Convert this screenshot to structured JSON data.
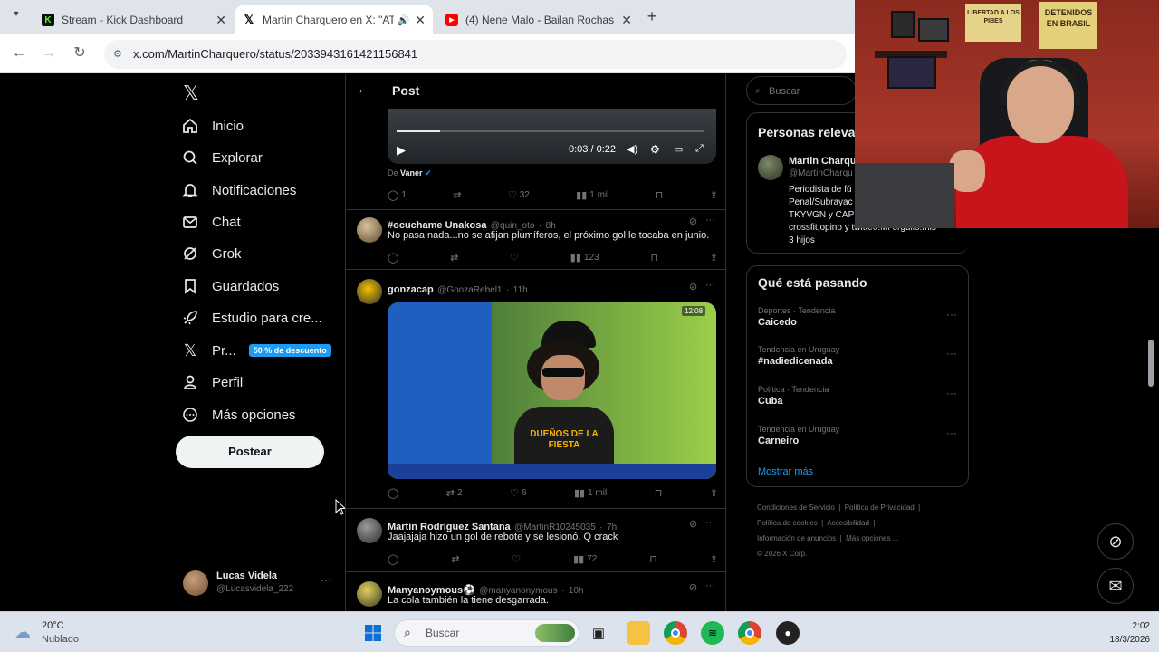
{
  "browser": {
    "tabs": [
      {
        "title": "Stream - Kick Dashboard",
        "icon": "kick-icon",
        "color": "#53fc18"
      },
      {
        "title": "Martin Charquero en X: \"AT",
        "icon": "x-logo-icon"
      },
      {
        "title": "(4) Nene Malo - Bailan Rochas",
        "icon": "youtube-icon",
        "color": "#ff0000"
      }
    ],
    "url": "x.com/MartinCharquero/status/2033943161421156841"
  },
  "header": {
    "title": "Post"
  },
  "nav": {
    "items": [
      {
        "label": "Inicio",
        "icon": "home-icon"
      },
      {
        "label": "Explorar",
        "icon": "search-icon"
      },
      {
        "label": "Notificaciones",
        "icon": "bell-icon"
      },
      {
        "label": "Chat",
        "icon": "mail-icon"
      },
      {
        "label": "Grok",
        "icon": "grok-icon"
      },
      {
        "label": "Guardados",
        "icon": "bookmark-icon"
      },
      {
        "label": "Estudio para cre...",
        "icon": "rocket-icon"
      },
      {
        "label": "Pr...",
        "icon": "x-premium-icon"
      },
      {
        "label": "Perfil",
        "icon": "person-icon"
      },
      {
        "label": "Más opciones",
        "icon": "more-circle-icon"
      }
    ],
    "premium_badge": "50 % de descuento",
    "post_button": "Postear",
    "user": {
      "name": "Lucas Videla",
      "handle": "@Lucasvidela_222"
    }
  },
  "video": {
    "time": "0:03 / 0:22",
    "from_label": "De",
    "from_name": "Vaner"
  },
  "video_stats": {
    "replies": "1",
    "likes": "32",
    "views": "1 mil"
  },
  "replies": [
    {
      "name": "#ocuchame Unakosa",
      "handle": "@quin_oto",
      "time": "8h",
      "text": "No pasa nada...no se afijan plumíferos, el próximo gol le tocaba en junio.",
      "views": "123"
    },
    {
      "name": "gonzacap",
      "handle": "@GonzaRebel1",
      "time": "11h",
      "text": "",
      "media_duration": "12:08",
      "media_caption": "DUEÑOS DE LA FIESTA",
      "retweets": "2",
      "likes": "6",
      "views": "1 mil"
    },
    {
      "name": "Martín Rodríguez Santana",
      "handle": "@MartinR10245035",
      "time": "7h",
      "text": "Jaajajaja hizo un gol de rebote y se lesionó. Q crack",
      "views": "72"
    },
    {
      "name": "Manyanoymous⚽",
      "handle": "@manyanonymous",
      "time": "10h",
      "text": "La cola también la tiene desgarrada."
    }
  ],
  "sidebar": {
    "search_placeholder": "Buscar",
    "relevant_title": "Personas releva",
    "relevant_person": {
      "name": "Martin Charqu",
      "handle": "@MartinCharqu",
      "bio": [
        "Periodista de fú",
        "Penal/Subrayac",
        "TKYVGN y CAP",
        "crossfit,opino y twitteo.Mi orgullo.mis",
        "3 hijos"
      ]
    },
    "trending_title": "Qué está pasando",
    "trends": [
      {
        "category": "Deportes · Tendencia",
        "name": "Caicedo"
      },
      {
        "category": "Tendencia en Uruguay",
        "name": "#nadiedicenada"
      },
      {
        "category": "Política · Tendencia",
        "name": "Cuba"
      },
      {
        "category": "Tendencia en Uruguay",
        "name": "Carneiro"
      }
    ],
    "show_more": "Mostrar más",
    "footer": [
      "Condiciones de Servicio",
      "Política de Privacidad",
      "Política de cookies",
      "Accesibilidad",
      "Información de anuncios",
      "Más opciones ...",
      "© 2026 X Corp."
    ]
  },
  "webcam_signs": [
    "LIBERTAD A LOS PIBES",
    "DETENIDOS EN BRASIL"
  ],
  "taskbar": {
    "weather_temp": "20°C",
    "weather_desc": "Nublado",
    "search_placeholder": "Buscar",
    "time": "2:02",
    "date": "18/3/2026"
  }
}
